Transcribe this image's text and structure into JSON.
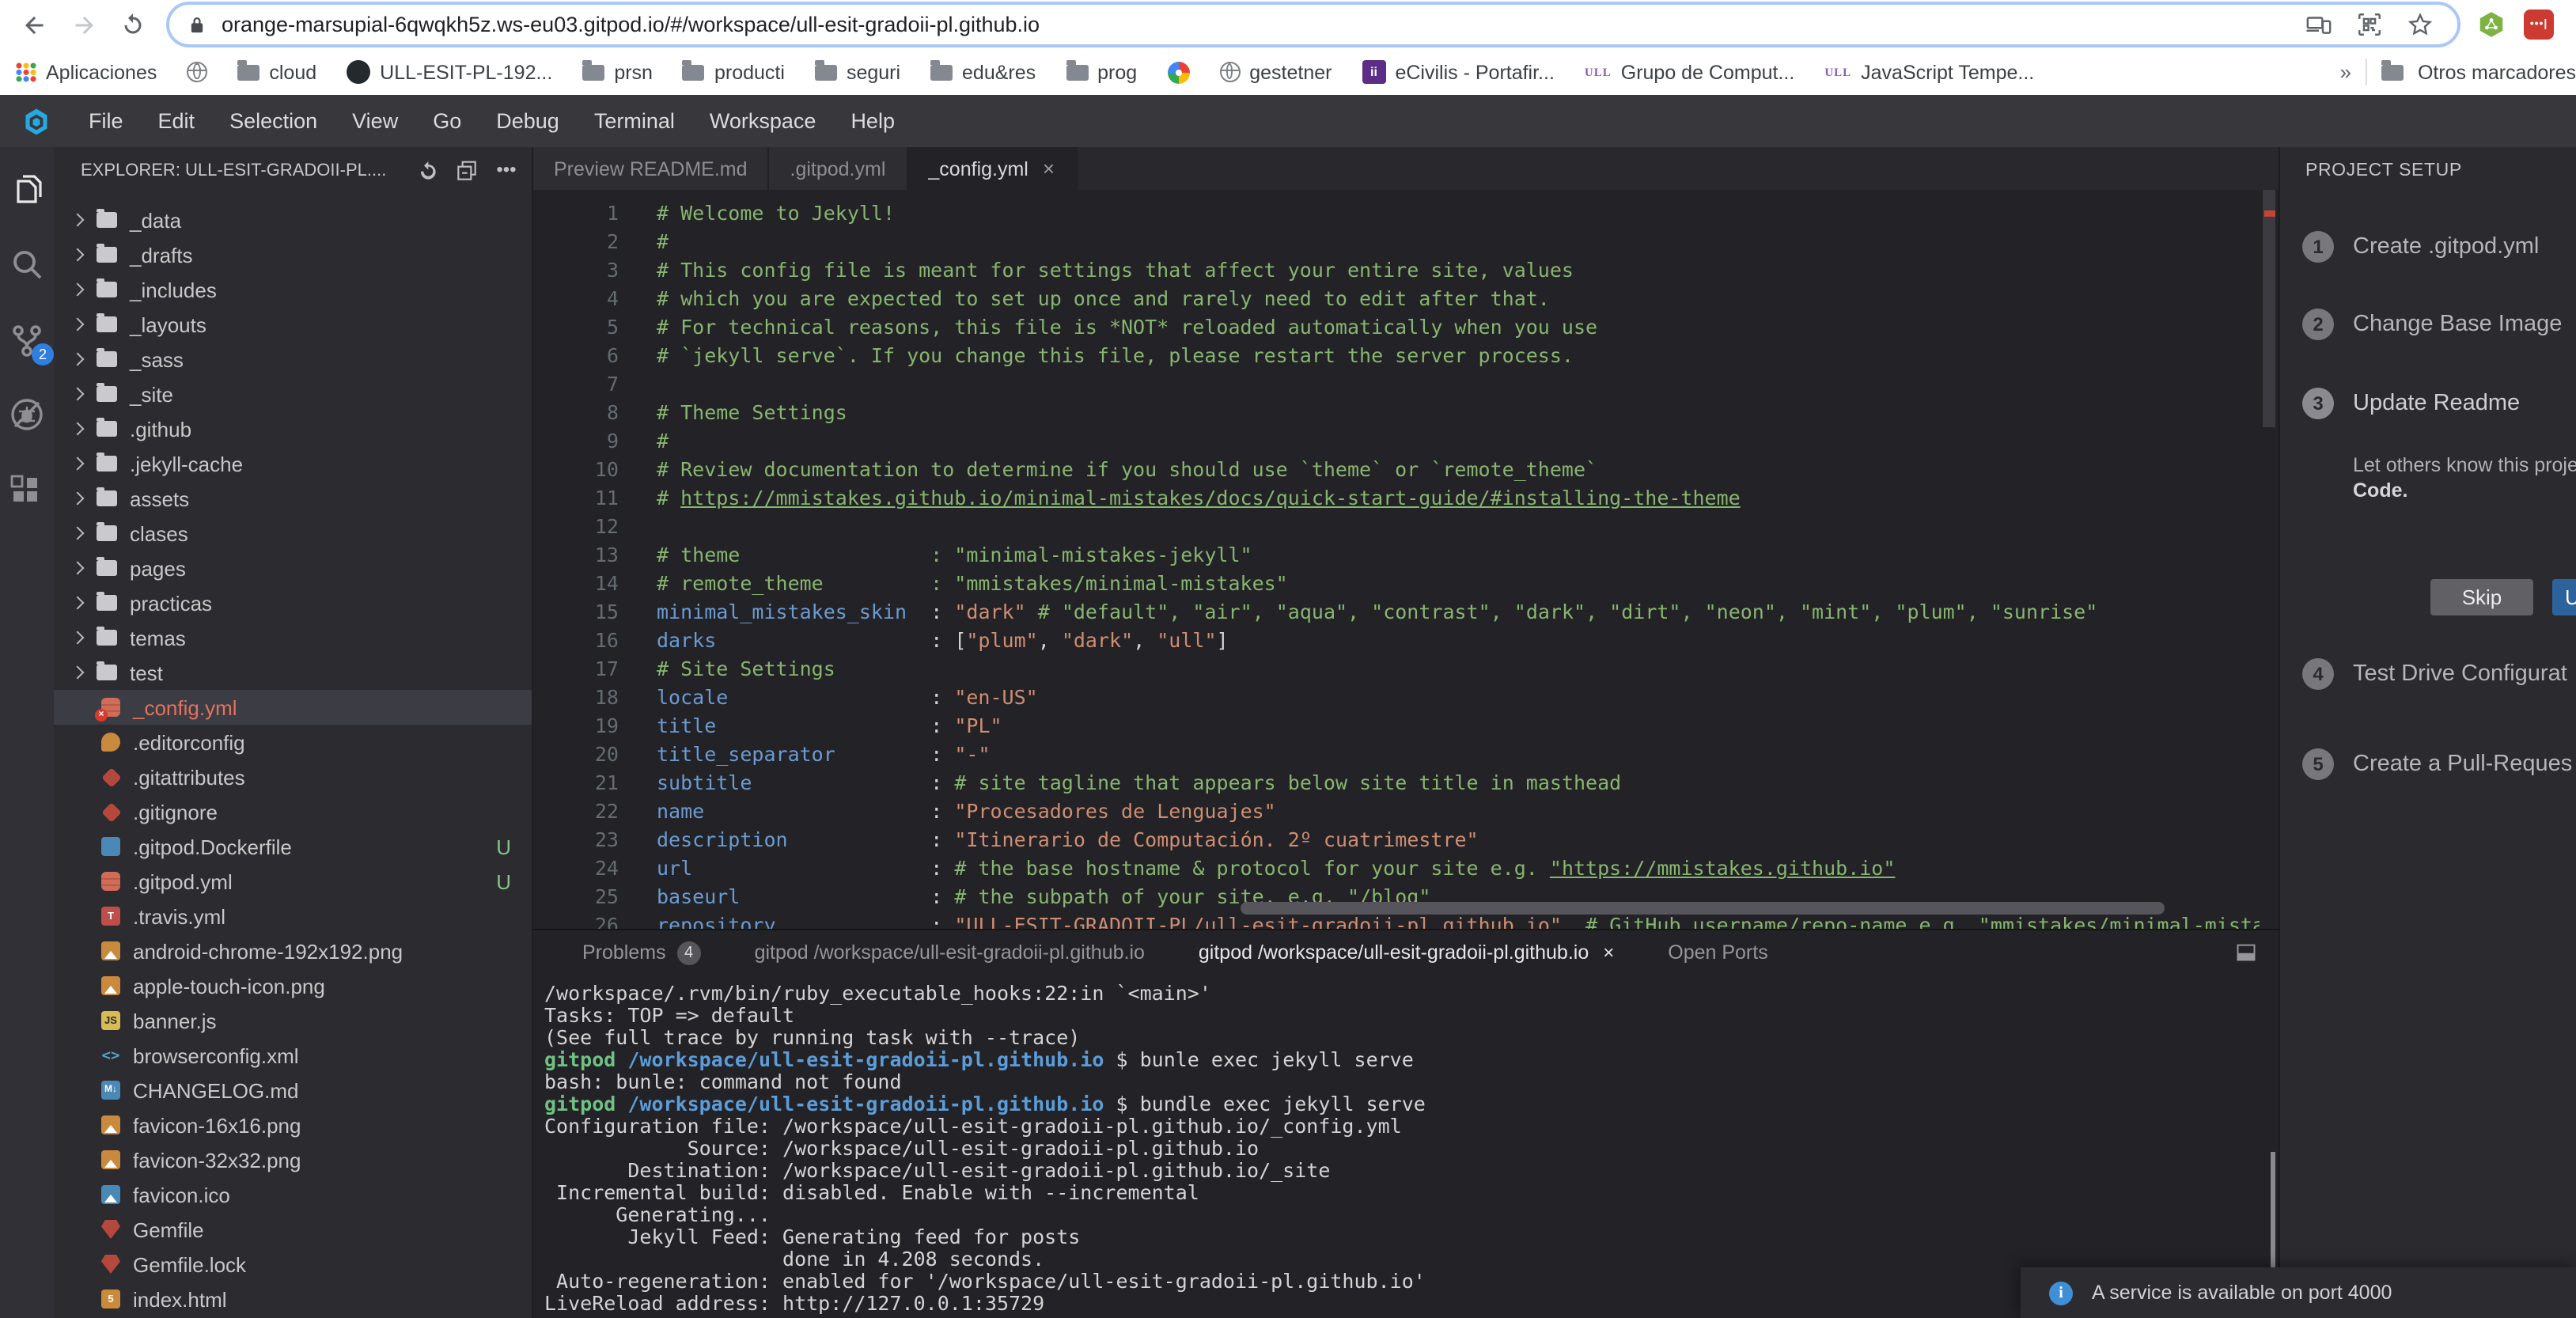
{
  "browser": {
    "url": "orange-marsupial-6qwqkh5z.ws-eu03.gitpod.io/#/workspace/ull-esit-gradoii-pl.github.io",
    "bookmarks": [
      {
        "icon": "apps-grid",
        "label": "Aplicaciones"
      },
      {
        "icon": "globe",
        "label": ""
      },
      {
        "icon": "folder",
        "label": "cloud"
      },
      {
        "icon": "github",
        "label": "ULL-ESIT-PL-192..."
      },
      {
        "icon": "folder",
        "label": "prsn"
      },
      {
        "icon": "folder",
        "label": "producti"
      },
      {
        "icon": "folder",
        "label": "seguri"
      },
      {
        "icon": "folder",
        "label": "edu&res"
      },
      {
        "icon": "folder",
        "label": "prog"
      },
      {
        "icon": "pinwheel",
        "label": ""
      },
      {
        "icon": "globe",
        "label": "gestetner"
      },
      {
        "icon": "ecivilis",
        "label": "eCivilis - Portafir..."
      },
      {
        "icon": "ull",
        "label": "Grupo de Comput..."
      },
      {
        "icon": "ull",
        "label": "JavaScript Tempe..."
      }
    ],
    "overflow_chevron": "»",
    "other_bookmarks": "Otros marcadores"
  },
  "menubar": {
    "items": [
      "File",
      "Edit",
      "Selection",
      "View",
      "Go",
      "Debug",
      "Terminal",
      "Workspace",
      "Help"
    ]
  },
  "activity_bar": {
    "git_badge": "2"
  },
  "explorer": {
    "header": "EXPLORER: ULL-ESIT-GRADOII-PL....",
    "items": [
      {
        "name": "_data",
        "type": "folder"
      },
      {
        "name": "_drafts",
        "type": "folder"
      },
      {
        "name": "_includes",
        "type": "folder"
      },
      {
        "name": "_layouts",
        "type": "folder"
      },
      {
        "name": "_sass",
        "type": "folder"
      },
      {
        "name": "_site",
        "type": "folder"
      },
      {
        "name": ".github",
        "type": "folder"
      },
      {
        "name": ".jekyll-cache",
        "type": "folder"
      },
      {
        "name": "assets",
        "type": "folder"
      },
      {
        "name": "clases",
        "type": "folder"
      },
      {
        "name": "pages",
        "type": "folder"
      },
      {
        "name": "practicas",
        "type": "folder"
      },
      {
        "name": "temas",
        "type": "folder"
      },
      {
        "name": "test",
        "type": "folder"
      },
      {
        "name": "_config.yml",
        "type": "file",
        "icon": "yaml",
        "error": true,
        "selected": true
      },
      {
        "name": ".editorconfig",
        "type": "file",
        "icon": "mouse"
      },
      {
        "name": ".gitattributes",
        "type": "file",
        "icon": "git"
      },
      {
        "name": ".gitignore",
        "type": "file",
        "icon": "git"
      },
      {
        "name": ".gitpod.Dockerfile",
        "type": "file",
        "icon": "docker",
        "badge": "U"
      },
      {
        "name": ".gitpod.yml",
        "type": "file",
        "icon": "yaml",
        "badge": "U"
      },
      {
        "name": ".travis.yml",
        "type": "file",
        "icon": "travis"
      },
      {
        "name": "android-chrome-192x192.png",
        "type": "file",
        "icon": "image"
      },
      {
        "name": "apple-touch-icon.png",
        "type": "file",
        "icon": "image"
      },
      {
        "name": "banner.js",
        "type": "file",
        "icon": "js"
      },
      {
        "name": "browserconfig.xml",
        "type": "file",
        "icon": "xml"
      },
      {
        "name": "CHANGELOG.md",
        "type": "file",
        "icon": "markdown"
      },
      {
        "name": "favicon-16x16.png",
        "type": "file",
        "icon": "image"
      },
      {
        "name": "favicon-32x32.png",
        "type": "file",
        "icon": "image"
      },
      {
        "name": "favicon.ico",
        "type": "file",
        "icon": "image-blue"
      },
      {
        "name": "Gemfile",
        "type": "file",
        "icon": "gem"
      },
      {
        "name": "Gemfile.lock",
        "type": "file",
        "icon": "gem"
      },
      {
        "name": "index.html",
        "type": "file",
        "icon": "html"
      }
    ]
  },
  "editor": {
    "tabs": [
      {
        "label": "Preview README.md"
      },
      {
        "label": ".gitpod.yml"
      },
      {
        "label": "_config.yml",
        "close": "×",
        "active": true
      }
    ],
    "lines": [
      {
        "s": [
          [
            "c",
            "# Welcome to Jekyll!"
          ]
        ]
      },
      {
        "s": [
          [
            "c",
            "#"
          ]
        ]
      },
      {
        "s": [
          [
            "c",
            "# This config file is meant for settings that affect your entire site, values"
          ]
        ]
      },
      {
        "s": [
          [
            "c",
            "# which you are expected to set up once and rarely need to edit after that."
          ]
        ]
      },
      {
        "s": [
          [
            "c",
            "# For technical reasons, this file is *NOT* reloaded automatically when you use"
          ]
        ]
      },
      {
        "s": [
          [
            "c",
            "# `jekyll serve`. If you change this file, please restart the server process."
          ]
        ]
      },
      {
        "s": []
      },
      {
        "s": [
          [
            "c",
            "# Theme Settings"
          ]
        ]
      },
      {
        "s": [
          [
            "c",
            "#"
          ]
        ]
      },
      {
        "s": [
          [
            "c",
            "# Review documentation to determine if you should use `theme` or `remote_theme`"
          ]
        ]
      },
      {
        "s": [
          [
            "c",
            "# "
          ],
          [
            "cu",
            "https://mmistakes.github.io/minimal-mistakes/docs/quick-start-guide/#installing-the-theme"
          ]
        ]
      },
      {
        "s": []
      },
      {
        "s": [
          [
            "c",
            "# theme                : \"minimal-mistakes-jekyll\""
          ]
        ]
      },
      {
        "s": [
          [
            "c",
            "# remote_theme         : \"mmistakes/minimal-mistakes\""
          ]
        ]
      },
      {
        "s": [
          [
            "k",
            "minimal_mistakes_skin"
          ],
          [
            "d",
            "  "
          ],
          [
            "p",
            ": "
          ],
          [
            "s",
            "\"dark\""
          ],
          [
            "d",
            " "
          ],
          [
            "c",
            "# \"default\", \"air\", \"aqua\", \"contrast\", \"dark\", \"dirt\", \"neon\", \"mint\", \"plum\", \"sunrise\""
          ]
        ]
      },
      {
        "s": [
          [
            "k",
            "darks"
          ],
          [
            "d",
            "                  "
          ],
          [
            "p",
            ": ["
          ],
          [
            "s",
            "\"plum\""
          ],
          [
            "p",
            ", "
          ],
          [
            "s",
            "\"dark\""
          ],
          [
            "p",
            ", "
          ],
          [
            "s",
            "\"ull\""
          ],
          [
            "p",
            "]"
          ]
        ]
      },
      {
        "s": [
          [
            "c",
            "# Site Settings"
          ]
        ]
      },
      {
        "s": [
          [
            "k",
            "locale"
          ],
          [
            "d",
            "                 "
          ],
          [
            "p",
            ": "
          ],
          [
            "s",
            "\"en-US\""
          ]
        ]
      },
      {
        "s": [
          [
            "k",
            "title"
          ],
          [
            "d",
            "                  "
          ],
          [
            "p",
            ": "
          ],
          [
            "s",
            "\"PL\""
          ]
        ]
      },
      {
        "s": [
          [
            "k",
            "title_separator"
          ],
          [
            "d",
            "        "
          ],
          [
            "p",
            ": "
          ],
          [
            "s",
            "\"-\""
          ]
        ]
      },
      {
        "s": [
          [
            "k",
            "subtitle"
          ],
          [
            "d",
            "               "
          ],
          [
            "p",
            ": "
          ],
          [
            "c",
            "# site tagline that appears below site title in masthead"
          ]
        ]
      },
      {
        "s": [
          [
            "k",
            "name"
          ],
          [
            "d",
            "                   "
          ],
          [
            "p",
            ": "
          ],
          [
            "s",
            "\"Procesadores de Lenguajes\""
          ]
        ]
      },
      {
        "s": [
          [
            "k",
            "description"
          ],
          [
            "d",
            "            "
          ],
          [
            "p",
            ": "
          ],
          [
            "s",
            "\"Itinerario de Computación. 2º cuatrimestre\""
          ]
        ]
      },
      {
        "s": [
          [
            "k",
            "url"
          ],
          [
            "d",
            "                    "
          ],
          [
            "p",
            ": "
          ],
          [
            "c",
            "# the base hostname & protocol for your site e.g. "
          ],
          [
            "cu",
            "\"https://mmistakes.github.io\""
          ]
        ]
      },
      {
        "s": [
          [
            "k",
            "baseurl"
          ],
          [
            "d",
            "                "
          ],
          [
            "p",
            ": "
          ],
          [
            "c",
            "# the subpath of your site, e.g. \"/blog\""
          ]
        ]
      },
      {
        "s": [
          [
            "k",
            "repository"
          ],
          [
            "d",
            "             "
          ],
          [
            "p",
            ": "
          ],
          [
            "s",
            "\"ULL-ESIT-GRADOII-PL/ull-esit-gradoii-pl.github.io\""
          ],
          [
            "d",
            "  "
          ],
          [
            "c",
            "# GitHub username/repo-name e.g. \"mmistakes/minimal-mistakes\""
          ]
        ]
      }
    ]
  },
  "panel": {
    "tabs": [
      {
        "label": "Problems",
        "badge": "4"
      },
      {
        "label": "gitpod /workspace/ull-esit-gradoii-pl.github.io"
      },
      {
        "label": "gitpod /workspace/ull-esit-gradoii-pl.github.io",
        "close": "×",
        "active": true
      },
      {
        "label": "Open Ports"
      }
    ],
    "terminal_lines": [
      {
        "s": [
          [
            "d",
            "/workspace/.rvm/bin/ruby_executable_hooks:22:in `<main>'"
          ]
        ]
      },
      {
        "s": [
          [
            "d",
            "Tasks: TOP => default"
          ]
        ]
      },
      {
        "s": [
          [
            "d",
            "(See full trace by running task with --trace)"
          ]
        ]
      },
      {
        "s": [
          [
            "g",
            "gitpod"
          ],
          [
            "d",
            " "
          ],
          [
            "b",
            "/workspace/ull-esit-gradoii-pl.github.io"
          ],
          [
            "d",
            " $ bunle exec jekyll serve"
          ]
        ]
      },
      {
        "s": [
          [
            "d",
            "bash: bunle: command not found"
          ]
        ]
      },
      {
        "s": [
          [
            "g",
            "gitpod"
          ],
          [
            "d",
            " "
          ],
          [
            "b",
            "/workspace/ull-esit-gradoii-pl.github.io"
          ],
          [
            "d",
            " $ bundle exec jekyll serve"
          ]
        ]
      },
      {
        "s": [
          [
            "d",
            "Configuration file: /workspace/ull-esit-gradoii-pl.github.io/_config.yml"
          ]
        ]
      },
      {
        "s": [
          [
            "d",
            "            Source: /workspace/ull-esit-gradoii-pl.github.io"
          ]
        ]
      },
      {
        "s": [
          [
            "d",
            "       Destination: /workspace/ull-esit-gradoii-pl.github.io/_site"
          ]
        ]
      },
      {
        "s": [
          [
            "d",
            " Incremental build: disabled. Enable with --incremental"
          ]
        ]
      },
      {
        "s": [
          [
            "d",
            "      Generating..."
          ]
        ]
      },
      {
        "s": [
          [
            "d",
            "       Jekyll Feed: Generating feed for posts"
          ]
        ]
      },
      {
        "s": [
          [
            "d",
            "                    done in 4.208 seconds."
          ]
        ]
      },
      {
        "s": [
          [
            "d",
            " Auto-regeneration: enabled for '/workspace/ull-esit-gradoii-pl.github.io'"
          ]
        ]
      },
      {
        "s": [
          [
            "d",
            "LiveReload address: http://127.0.0.1:35729"
          ]
        ]
      }
    ]
  },
  "project_setup": {
    "title": "PROJECT SETUP",
    "steps": [
      {
        "num": "1",
        "label": "Create .gitpod.yml"
      },
      {
        "num": "2",
        "label": "Change Base Image"
      },
      {
        "num": "3",
        "label": "Update Readme",
        "active": true
      },
      {
        "num": "4",
        "label": "Test Drive Configurat"
      },
      {
        "num": "5",
        "label": "Create a Pull-Reques"
      }
    ],
    "step3_desc_line1": "Let others know this proje",
    "step3_desc_line2": "Code.",
    "skip_label": "Skip",
    "update_label": "U"
  },
  "notification": {
    "text": "A service is available on port 4000"
  }
}
